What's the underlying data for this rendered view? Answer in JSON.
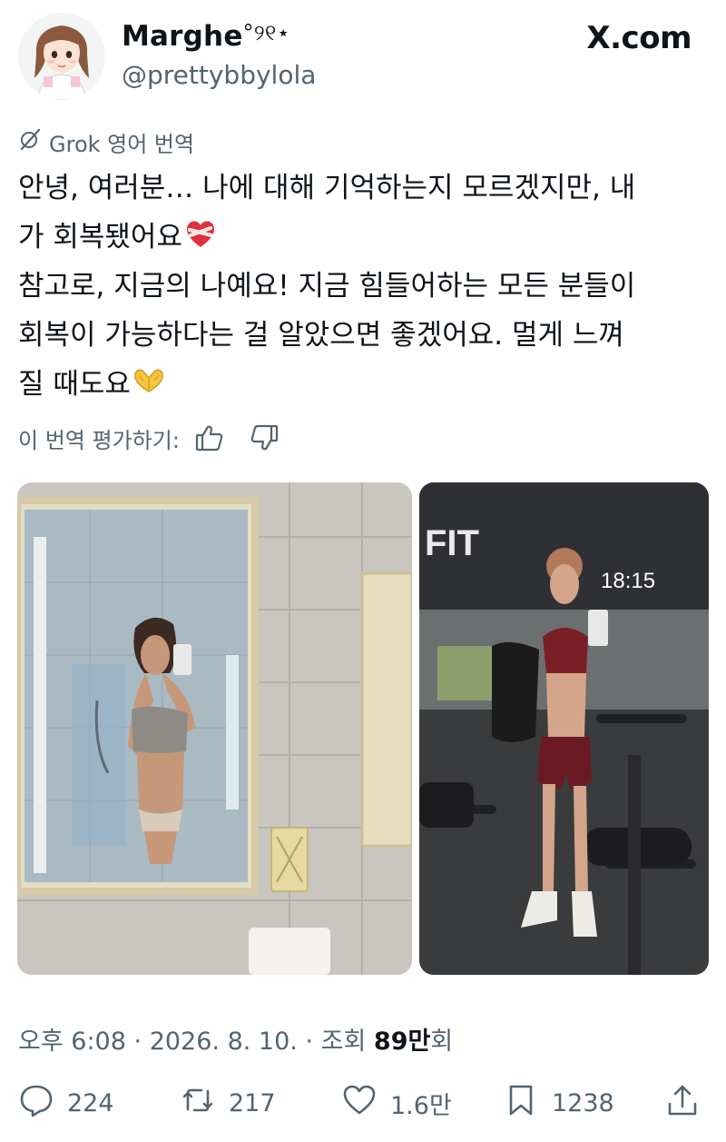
{
  "tweet": {
    "author": {
      "display_name": "Marghe",
      "name_decoration": "°୨୧⋆",
      "handle": "@prettybbylola"
    },
    "brand": {
      "label": "X.com"
    },
    "translation": {
      "label": "Grok 영어 번역",
      "rate_label": "이 번역 평가하기:"
    },
    "text_lines": [
      "안녕, 여러분… 나에 대해 기억하는지 모르겠지만, 내",
      "가 회복됐어요",
      "참고로, 지금의 나예요! 지금 힘들어하는 모든 분들이",
      "회복이 가능하다는 걸 알았으면 좋겠어요. 멀게 느껴",
      "질 때도요"
    ],
    "emojis": [
      "mending-heart-emoji",
      "heart-hands-emoji"
    ],
    "photo_right_time_text": "18:15",
    "photo_right_sign_text": "FIT",
    "meta": {
      "time": "오후 6:08",
      "separator": "·",
      "date": "2026. 8. 10.",
      "views_prefix": "조회",
      "views_count": "89만",
      "views_suffix": "회"
    },
    "stats": {
      "replies": "224",
      "reposts": "217",
      "likes": "1.6만",
      "bookmarks": "1238"
    },
    "icons": [
      "grok-icon",
      "thumbs-up-icon",
      "thumbs-down-icon",
      "reply-icon",
      "repost-icon",
      "like-icon",
      "bookmark-icon",
      "share-icon"
    ],
    "colors": {
      "text": "#0f1419",
      "secondary": "#536471"
    }
  }
}
